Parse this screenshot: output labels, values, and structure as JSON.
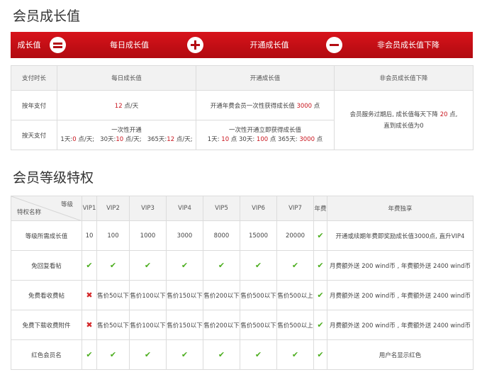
{
  "section1_title": "会员成长值",
  "banner": {
    "growth": "成长值",
    "daily": "每日成长值",
    "activate": "开通成长值",
    "nonmember": "非会员成长值下降"
  },
  "growth_table": {
    "headers": [
      "支付时长",
      "每日成长值",
      "开通成长值",
      "非会员成长值下降"
    ],
    "rows": [
      {
        "label": "按年支付",
        "daily_num": "12",
        "daily_unit": " 点/天",
        "act_pre": "开通年费会员一次性获得成长值 ",
        "act_num": "3000",
        "act_post": " 点"
      },
      {
        "label": "按天支付",
        "daily_line1": "一次性开通",
        "daily_parts": [
          "1天:",
          "0",
          " 点/天;   30天:",
          "10",
          " 点/天;   365天:",
          "12",
          " 点/天;"
        ],
        "act_line1": "一次性开通立即获得成长值",
        "act_parts": [
          "1天: ",
          "10",
          " 点 30天: ",
          "100",
          " 点 365天: ",
          "3000",
          " 点"
        ]
      }
    ],
    "nonmember_pre": "会员服务过期后, 成长值每天下降 ",
    "nonmember_num": "20",
    "nonmember_mid": " 点,",
    "nonmember_line2": "直到成长值为0"
  },
  "section2_title": "会员等级特权",
  "level_table": {
    "corner_top": "等级",
    "corner_bottom": "特权名称",
    "columns": [
      "VIP1",
      "VIP2",
      "VIP3",
      "VIP4",
      "VIP5",
      "VIP6",
      "VIP7",
      "年费",
      "年费独享"
    ],
    "rows": [
      {
        "name": "等级所需成长值",
        "cells": [
          "10",
          "100",
          "1000",
          "3000",
          "8000",
          "15000",
          "20000"
        ],
        "annual": "check",
        "exclusive": "开通或续期年费即奖励成长值3000点, 直升VIP4"
      },
      {
        "name": "免回复看帖",
        "cells": [
          "check",
          "check",
          "check",
          "check",
          "check",
          "check",
          "check"
        ],
        "annual": "check",
        "exclusive": "月费额外送 200 wind币 , 年费额外送 2400 wind币"
      },
      {
        "name": "免费看收费帖",
        "cells": [
          "cross",
          "售价50以下",
          "售价100以下",
          "售价150以下",
          "售价200以下",
          "售价500以下",
          "售价500以上"
        ],
        "annual": "check",
        "exclusive": "月费额外送 200 wind币 , 年费额外送 2400 wind币"
      },
      {
        "name": "免费下载收费附件",
        "cells": [
          "cross",
          "售价50以下",
          "售价100以下",
          "售价150以下",
          "售价200以下",
          "售价500以下",
          "售价500以上"
        ],
        "annual": "check",
        "exclusive": "月费额外送 200 wind币 , 年费额外送 2400 wind币"
      },
      {
        "name": "红色会员名",
        "cells": [
          "check",
          "check",
          "check",
          "check",
          "check",
          "check",
          "check"
        ],
        "annual": "check",
        "exclusive": "用户名显示红色"
      }
    ]
  },
  "icons": {
    "check": "check-icon",
    "cross": "cross-icon",
    "plus": "plus-icon",
    "equals": "equals-icon",
    "minus": "minus-icon"
  },
  "colors": {
    "banner": "#c8101a",
    "accent_red": "#c9151e",
    "check_green": "#4cae1f"
  }
}
